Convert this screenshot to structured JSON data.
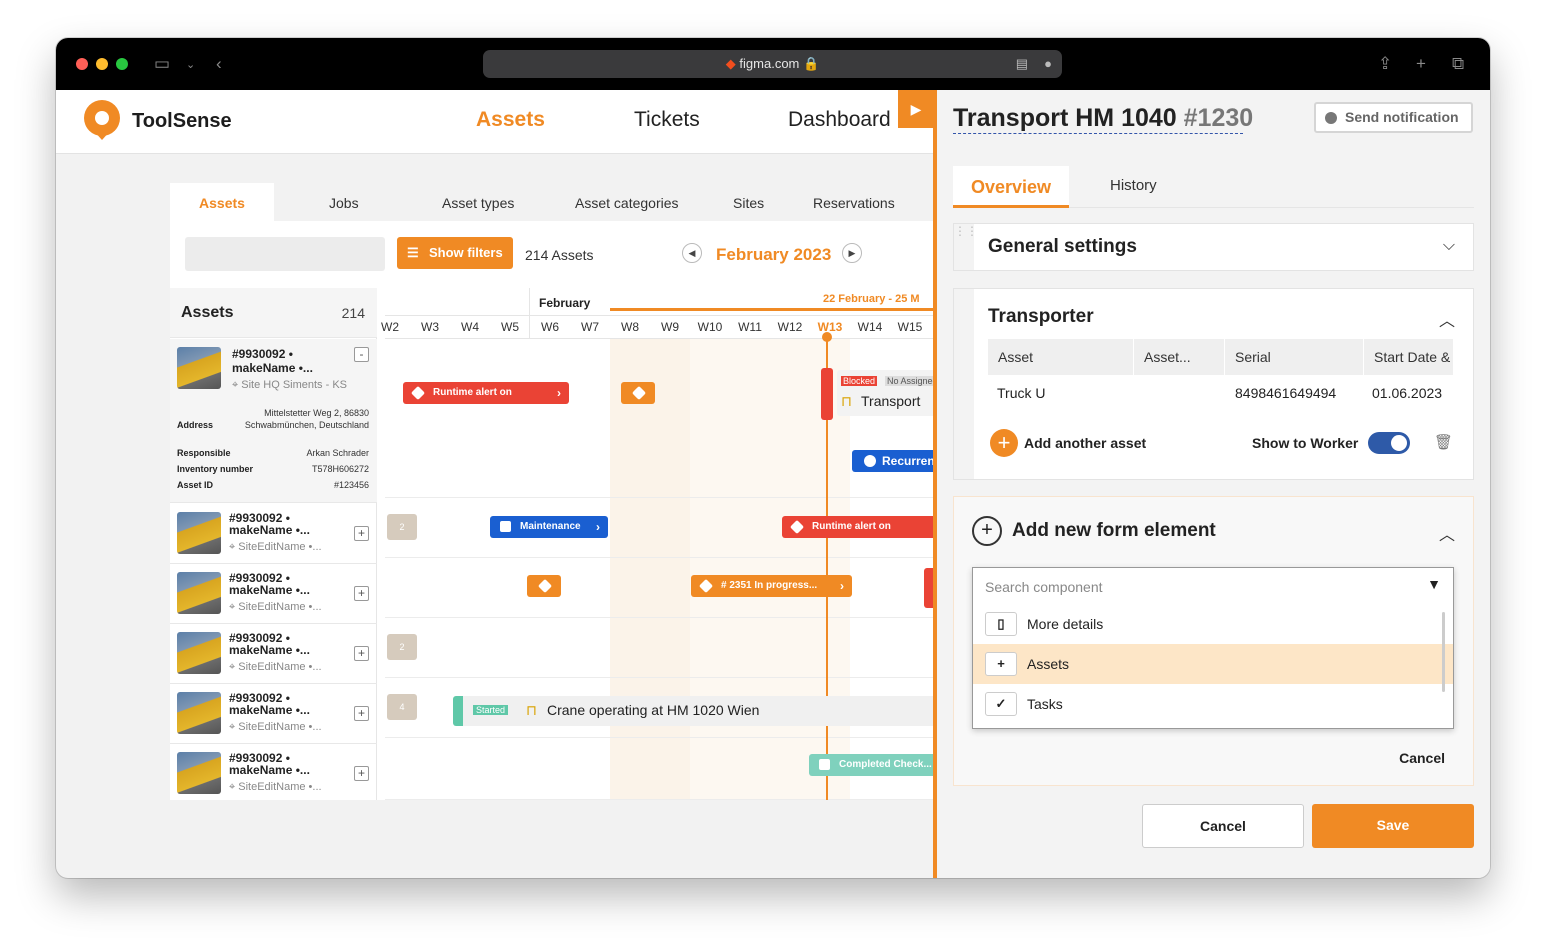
{
  "browser": {
    "url": "figma.com"
  },
  "app": {
    "brand": "ToolSense",
    "nav": [
      "Assets",
      "Tickets",
      "Dashboard"
    ],
    "colors": {
      "accent": "#f08a24",
      "blue": "#1a5fd1",
      "red": "#ea4335"
    }
  },
  "subtabs": [
    "Assets",
    "Jobs",
    "Asset types",
    "Asset categories",
    "Sites",
    "Reservations"
  ],
  "toolbar": {
    "show_filters": "Show filters",
    "asset_count": "214 Assets",
    "month": "February 2023"
  },
  "asset_list": {
    "title": "Assets",
    "count": "214",
    "expanded": {
      "id": "#9930092 •",
      "name": "makeName •...",
      "site": "Site HQ Siments - KS",
      "details": [
        {
          "label": "Address",
          "value": "Mittelstetter Weg 2, 86830 Schwabmünchen, Deutschland"
        },
        {
          "label": "Responsible",
          "value": "Arkan Schrader"
        },
        {
          "label": "Inventory number",
          "value": "T578H606272"
        },
        {
          "label": "Asset ID",
          "value": "#123456"
        }
      ]
    },
    "rows": [
      {
        "id": "#9930092 •",
        "name": "makeName •...",
        "site": "SiteEditName •..."
      },
      {
        "id": "#9930092 •",
        "name": "makeName •...",
        "site": "SiteEditName •..."
      },
      {
        "id": "#9930092 •",
        "name": "makeName •...",
        "site": "SiteEditName •..."
      },
      {
        "id": "#9930092 •",
        "name": "makeName •...",
        "site": "SiteEditName •..."
      },
      {
        "id": "#9930092 •",
        "name": "makeName •...",
        "site": "SiteEditName •..."
      }
    ]
  },
  "timeline": {
    "month_label": "February",
    "range_label": "22 February -  25 M",
    "weeks": [
      "W2",
      "W3",
      "W4",
      "W5",
      "W6",
      "W7",
      "W8",
      "W9",
      "W10",
      "W11",
      "W12",
      "W13",
      "W14",
      "W15"
    ],
    "current_week": "W13",
    "events": {
      "runtime_alert_1": "Runtime alert on",
      "blocked_tag": "Blocked",
      "no_assignee": "No Assignee",
      "transport": "Transport",
      "recurring": "Recurrent",
      "maintenance": "Maintenance",
      "runtime_alert_2": "Runtime alert on",
      "in_progress": "# 2351 In progress...",
      "started_tag": "Started",
      "crane": "Crane operating at HM 1020 Wien",
      "completed": "Completed Check...",
      "group_a": "2",
      "group_b": "2",
      "group_c": "4"
    }
  },
  "panel": {
    "title": "Transport HM 1040",
    "number": "#1230",
    "send_notification": "Send notification",
    "tabs": [
      "Overview",
      "History"
    ],
    "general_settings": "General settings",
    "transporter": {
      "title": "Transporter",
      "columns": [
        "Asset",
        "Asset...",
        "Serial",
        "Start Date & T"
      ],
      "row": {
        "asset": "Truck U",
        "serial": "8498461649494",
        "start": "01.06.2023"
      },
      "add_another": "Add another asset",
      "show_to_worker": "Show to Worker"
    },
    "add_form": {
      "title": "Add new form element",
      "search_placeholder": "Search component",
      "options": [
        {
          "label": "More details",
          "icon": "map-icon"
        },
        {
          "label": "Assets",
          "icon": "plus-icon",
          "highlighted": true
        },
        {
          "label": "Tasks",
          "icon": "check-icon"
        }
      ],
      "cancel": "Cancel"
    },
    "footer": {
      "cancel": "Cancel",
      "save": "Save"
    }
  }
}
